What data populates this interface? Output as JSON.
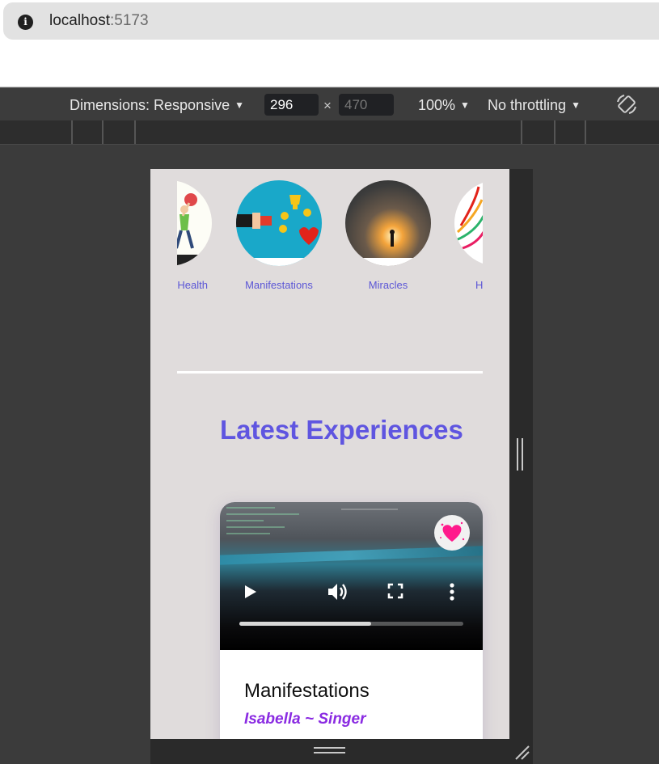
{
  "browser": {
    "url_host": "localhost",
    "url_port": ":5173"
  },
  "devtools": {
    "dimensions_label": "Dimensions: Responsive",
    "width_value": "296",
    "height_placeholder": "470",
    "times_sign": "×",
    "zoom_label": "100%",
    "throttling_label": "No throttling"
  },
  "page": {
    "categories": [
      {
        "label": "Health",
        "icon": "fitness-woman-image"
      },
      {
        "label": "Manifestations",
        "icon": "trophy-hand-image"
      },
      {
        "label": "Miracles",
        "icon": "light-figure-image"
      },
      {
        "label": "H",
        "icon": "lotus-image"
      }
    ],
    "section_title": "Latest Experiences",
    "card": {
      "title": "Manifestations",
      "author": "Isabella ~ Singer",
      "video_progress": 0.59,
      "favorite_icon": "heart-icon"
    }
  },
  "colors": {
    "accent": "#5f55e0",
    "author": "#8a2be2",
    "favorite": "#ff1a8c",
    "device_bg": "#e0dcdc"
  }
}
